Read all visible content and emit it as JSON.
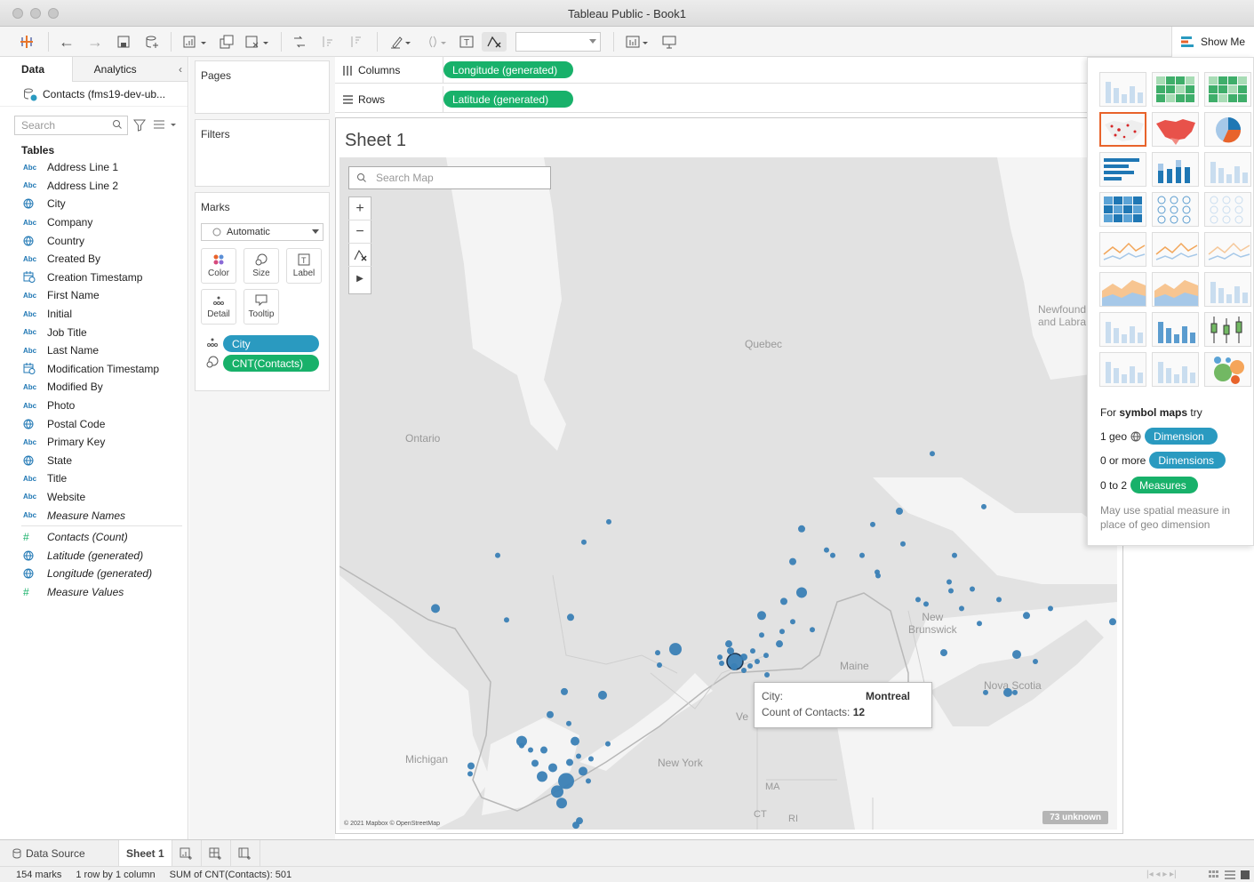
{
  "window": {
    "title": "Tableau Public - Book1"
  },
  "toolbar": {
    "show_me_label": "Show Me"
  },
  "datapane": {
    "tab_data": "Data",
    "tab_analytics": "Analytics",
    "datasource": "Contacts (fms19-dev-ub...",
    "search_placeholder": "Search",
    "tables_heading": "Tables",
    "fields": [
      {
        "name": "Address Line 1",
        "type": "abc"
      },
      {
        "name": "Address Line 2",
        "type": "abc"
      },
      {
        "name": "City",
        "type": "geo"
      },
      {
        "name": "Company",
        "type": "abc"
      },
      {
        "name": "Country",
        "type": "geo"
      },
      {
        "name": "Created By",
        "type": "abc"
      },
      {
        "name": "Creation Timestamp",
        "type": "date"
      },
      {
        "name": "First Name",
        "type": "abc"
      },
      {
        "name": "Initial",
        "type": "abc"
      },
      {
        "name": "Job Title",
        "type": "abc"
      },
      {
        "name": "Last Name",
        "type": "abc"
      },
      {
        "name": "Modification Timestamp",
        "type": "date"
      },
      {
        "name": "Modified By",
        "type": "abc"
      },
      {
        "name": "Photo",
        "type": "abc"
      },
      {
        "name": "Postal Code",
        "type": "geo"
      },
      {
        "name": "Primary Key",
        "type": "abc"
      },
      {
        "name": "State",
        "type": "geo"
      },
      {
        "name": "Title",
        "type": "abc"
      },
      {
        "name": "Website",
        "type": "abc"
      },
      {
        "name": "Measure Names",
        "type": "abc",
        "italic": true
      }
    ],
    "measures": [
      {
        "name": "Contacts (Count)",
        "type": "num"
      },
      {
        "name": "Latitude (generated)",
        "type": "geo"
      },
      {
        "name": "Longitude (generated)",
        "type": "geo"
      },
      {
        "name": "Measure Values",
        "type": "num"
      }
    ]
  },
  "shelves": {
    "pages": "Pages",
    "filters": "Filters",
    "marks": "Marks",
    "mark_type": "Automatic",
    "buttons": {
      "color": "Color",
      "size": "Size",
      "label": "Label",
      "detail": "Detail",
      "tooltip": "Tooltip"
    },
    "pill_city": "City",
    "pill_count": "CNT(Contacts)",
    "columns_label": "Columns",
    "rows_label": "Rows",
    "columns_pill": "Longitude (generated)",
    "rows_pill": "Latitude (generated)"
  },
  "sheet": {
    "title": "Sheet 1",
    "map_search_placeholder": "Search Map",
    "tooltip": {
      "city_label": "City:",
      "city_value": "Montreal",
      "count_label": "Count of Contacts:",
      "count_value": "12"
    },
    "unknown": "73 unknown",
    "attribution": "© 2021 Mapbox © OpenStreetMap",
    "labels": {
      "quebec": "Quebec",
      "ontario": "Ontario",
      "newfoundland_1": "Newfound",
      "newfoundland_2": "and Labra",
      "new_brunswick_1": "New",
      "new_brunswick_2": "Brunswick",
      "maine": "Maine",
      "nova_scotia": "Nova Scotia",
      "michigan": "Michigan",
      "new_york": "New York",
      "ma": "MA",
      "ct": "CT",
      "ri": "RI",
      "vt": "Ve"
    }
  },
  "showme": {
    "hint_prefix": "For ",
    "hint_bold": "symbol maps",
    "hint_suffix": " try",
    "req1_label": "1 geo",
    "req1_pill": "Dimension",
    "req2_label": "0 or more",
    "req2_pill": "Dimensions",
    "req3_label": "0 to 2",
    "req3_pill": "Measures",
    "note": "May use spatial measure in place of geo dimension"
  },
  "sheetbar": {
    "datasource_tab": "Data Source",
    "sheet_tab": "Sheet 1"
  },
  "status": {
    "marks": "154 marks",
    "dims": "1 row by 1 column",
    "sum": "SUM of CNT(Contacts): 501"
  },
  "colors": {
    "dimension": "#2a9ac0",
    "measure": "#18b16a",
    "mark": "#3a7fb5",
    "selected_thumb": "#e8632b"
  }
}
